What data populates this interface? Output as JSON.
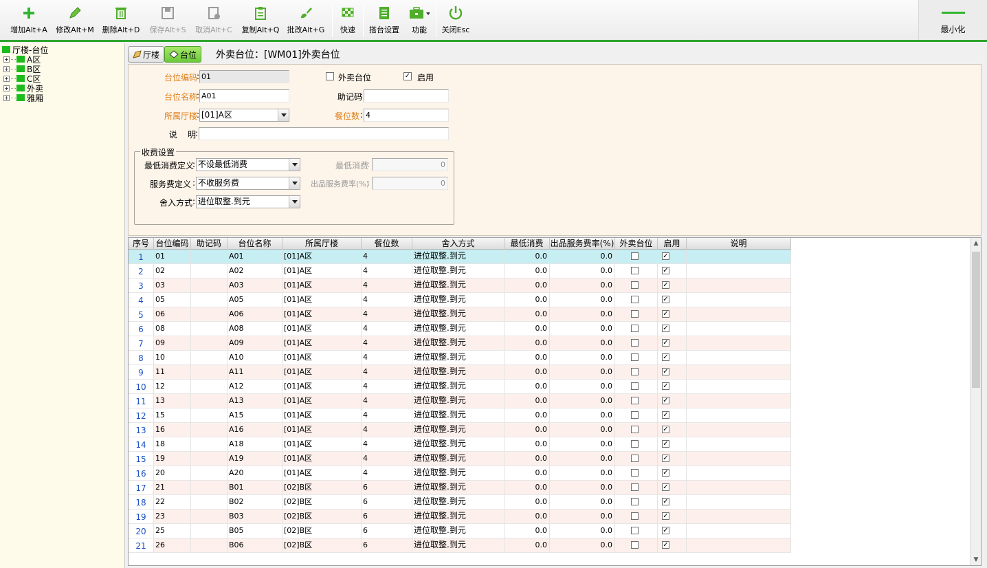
{
  "toolbar": {
    "add": "增加Alt+A",
    "edit": "修改Alt+M",
    "delete": "删除Alt+D",
    "save": "保存Alt+S",
    "cancel": "取消Alt+C",
    "copy": "复制Alt+Q",
    "batch_edit": "批改Alt+G",
    "quick": "快速",
    "table_setup": "搭台设置",
    "function": "功能",
    "close": "关闭Esc",
    "minimize": "最小化"
  },
  "tree": {
    "root": "厅楼-台位",
    "items": [
      "A区",
      "B区",
      "C区",
      "外卖",
      "雅厢"
    ]
  },
  "tabs": {
    "hall": "厅楼",
    "table": "台位",
    "title": "外卖台位：[WM01]外卖台位"
  },
  "form": {
    "code_label": "台位编码",
    "code_value": "01",
    "takeout_label": "外卖台位",
    "enabled_label": "启用",
    "name_label": "台位名称",
    "name_value": "A01",
    "mnemonic_label": "助记码",
    "mnemonic_value": "",
    "hall_label": "所属厅楼",
    "hall_value": "[01]A区",
    "seats_label": "餐位数",
    "seats_value": "4",
    "desc_label": "说    明",
    "desc_value": "",
    "fee_group": "收费设置",
    "min_def_label": "最低消费定义",
    "min_def_value": "不设最低消费",
    "min_label": "最低消费",
    "min_value": "0",
    "svc_def_label": "服务费定义",
    "svc_def_value": "不收服务费",
    "svc_rate_label": "出品服务费率(%)",
    "svc_rate_value": "0",
    "rounding_label": "舍入方式",
    "rounding_value": "进位取整.到元"
  },
  "grid": {
    "headers": [
      "序号",
      "台位编码",
      "助记码",
      "台位名称",
      "所属厅楼",
      "餐位数",
      "舍入方式",
      "最低消费",
      "出品服务费率(%)",
      "外卖台位",
      "启用",
      "说明"
    ],
    "rows": [
      {
        "no": "1",
        "code": "01",
        "mn": "",
        "name": "A01",
        "hall": "[01]A区",
        "seats": "4",
        "round": "进位取整.到元",
        "min": "0.0",
        "rate": "0.0",
        "take": false,
        "en": true,
        "desc": ""
      },
      {
        "no": "2",
        "code": "02",
        "mn": "",
        "name": "A02",
        "hall": "[01]A区",
        "seats": "4",
        "round": "进位取整.到元",
        "min": "0.0",
        "rate": "0.0",
        "take": false,
        "en": true,
        "desc": ""
      },
      {
        "no": "3",
        "code": "03",
        "mn": "",
        "name": "A03",
        "hall": "[01]A区",
        "seats": "4",
        "round": "进位取整.到元",
        "min": "0.0",
        "rate": "0.0",
        "take": false,
        "en": true,
        "desc": ""
      },
      {
        "no": "4",
        "code": "05",
        "mn": "",
        "name": "A05",
        "hall": "[01]A区",
        "seats": "4",
        "round": "进位取整.到元",
        "min": "0.0",
        "rate": "0.0",
        "take": false,
        "en": true,
        "desc": ""
      },
      {
        "no": "5",
        "code": "06",
        "mn": "",
        "name": "A06",
        "hall": "[01]A区",
        "seats": "4",
        "round": "进位取整.到元",
        "min": "0.0",
        "rate": "0.0",
        "take": false,
        "en": true,
        "desc": ""
      },
      {
        "no": "6",
        "code": "08",
        "mn": "",
        "name": "A08",
        "hall": "[01]A区",
        "seats": "4",
        "round": "进位取整.到元",
        "min": "0.0",
        "rate": "0.0",
        "take": false,
        "en": true,
        "desc": ""
      },
      {
        "no": "7",
        "code": "09",
        "mn": "",
        "name": "A09",
        "hall": "[01]A区",
        "seats": "4",
        "round": "进位取整.到元",
        "min": "0.0",
        "rate": "0.0",
        "take": false,
        "en": true,
        "desc": ""
      },
      {
        "no": "8",
        "code": "10",
        "mn": "",
        "name": "A10",
        "hall": "[01]A区",
        "seats": "4",
        "round": "进位取整.到元",
        "min": "0.0",
        "rate": "0.0",
        "take": false,
        "en": true,
        "desc": ""
      },
      {
        "no": "9",
        "code": "11",
        "mn": "",
        "name": "A11",
        "hall": "[01]A区",
        "seats": "4",
        "round": "进位取整.到元",
        "min": "0.0",
        "rate": "0.0",
        "take": false,
        "en": true,
        "desc": ""
      },
      {
        "no": "10",
        "code": "12",
        "mn": "",
        "name": "A12",
        "hall": "[01]A区",
        "seats": "4",
        "round": "进位取整.到元",
        "min": "0.0",
        "rate": "0.0",
        "take": false,
        "en": true,
        "desc": ""
      },
      {
        "no": "11",
        "code": "13",
        "mn": "",
        "name": "A13",
        "hall": "[01]A区",
        "seats": "4",
        "round": "进位取整.到元",
        "min": "0.0",
        "rate": "0.0",
        "take": false,
        "en": true,
        "desc": ""
      },
      {
        "no": "12",
        "code": "15",
        "mn": "",
        "name": "A15",
        "hall": "[01]A区",
        "seats": "4",
        "round": "进位取整.到元",
        "min": "0.0",
        "rate": "0.0",
        "take": false,
        "en": true,
        "desc": ""
      },
      {
        "no": "13",
        "code": "16",
        "mn": "",
        "name": "A16",
        "hall": "[01]A区",
        "seats": "4",
        "round": "进位取整.到元",
        "min": "0.0",
        "rate": "0.0",
        "take": false,
        "en": true,
        "desc": ""
      },
      {
        "no": "14",
        "code": "18",
        "mn": "",
        "name": "A18",
        "hall": "[01]A区",
        "seats": "4",
        "round": "进位取整.到元",
        "min": "0.0",
        "rate": "0.0",
        "take": false,
        "en": true,
        "desc": ""
      },
      {
        "no": "15",
        "code": "19",
        "mn": "",
        "name": "A19",
        "hall": "[01]A区",
        "seats": "4",
        "round": "进位取整.到元",
        "min": "0.0",
        "rate": "0.0",
        "take": false,
        "en": true,
        "desc": ""
      },
      {
        "no": "16",
        "code": "20",
        "mn": "",
        "name": "A20",
        "hall": "[01]A区",
        "seats": "4",
        "round": "进位取整.到元",
        "min": "0.0",
        "rate": "0.0",
        "take": false,
        "en": true,
        "desc": ""
      },
      {
        "no": "17",
        "code": "21",
        "mn": "",
        "name": "B01",
        "hall": "[02]B区",
        "seats": "6",
        "round": "进位取整.到元",
        "min": "0.0",
        "rate": "0.0",
        "take": false,
        "en": true,
        "desc": ""
      },
      {
        "no": "18",
        "code": "22",
        "mn": "",
        "name": "B02",
        "hall": "[02]B区",
        "seats": "6",
        "round": "进位取整.到元",
        "min": "0.0",
        "rate": "0.0",
        "take": false,
        "en": true,
        "desc": ""
      },
      {
        "no": "19",
        "code": "23",
        "mn": "",
        "name": "B03",
        "hall": "[02]B区",
        "seats": "6",
        "round": "进位取整.到元",
        "min": "0.0",
        "rate": "0.0",
        "take": false,
        "en": true,
        "desc": ""
      },
      {
        "no": "20",
        "code": "25",
        "mn": "",
        "name": "B05",
        "hall": "[02]B区",
        "seats": "6",
        "round": "进位取整.到元",
        "min": "0.0",
        "rate": "0.0",
        "take": false,
        "en": true,
        "desc": ""
      },
      {
        "no": "21",
        "code": "26",
        "mn": "",
        "name": "B06",
        "hall": "[02]B区",
        "seats": "6",
        "round": "进位取整.到元",
        "min": "0.0",
        "rate": "0.0",
        "take": false,
        "en": true,
        "desc": ""
      }
    ]
  },
  "colors": {
    "accent_green": "#2ea52e",
    "row_selected": "#c7eef2",
    "row_alt": "#fdf0ec",
    "label_orange": "#e0801a"
  }
}
